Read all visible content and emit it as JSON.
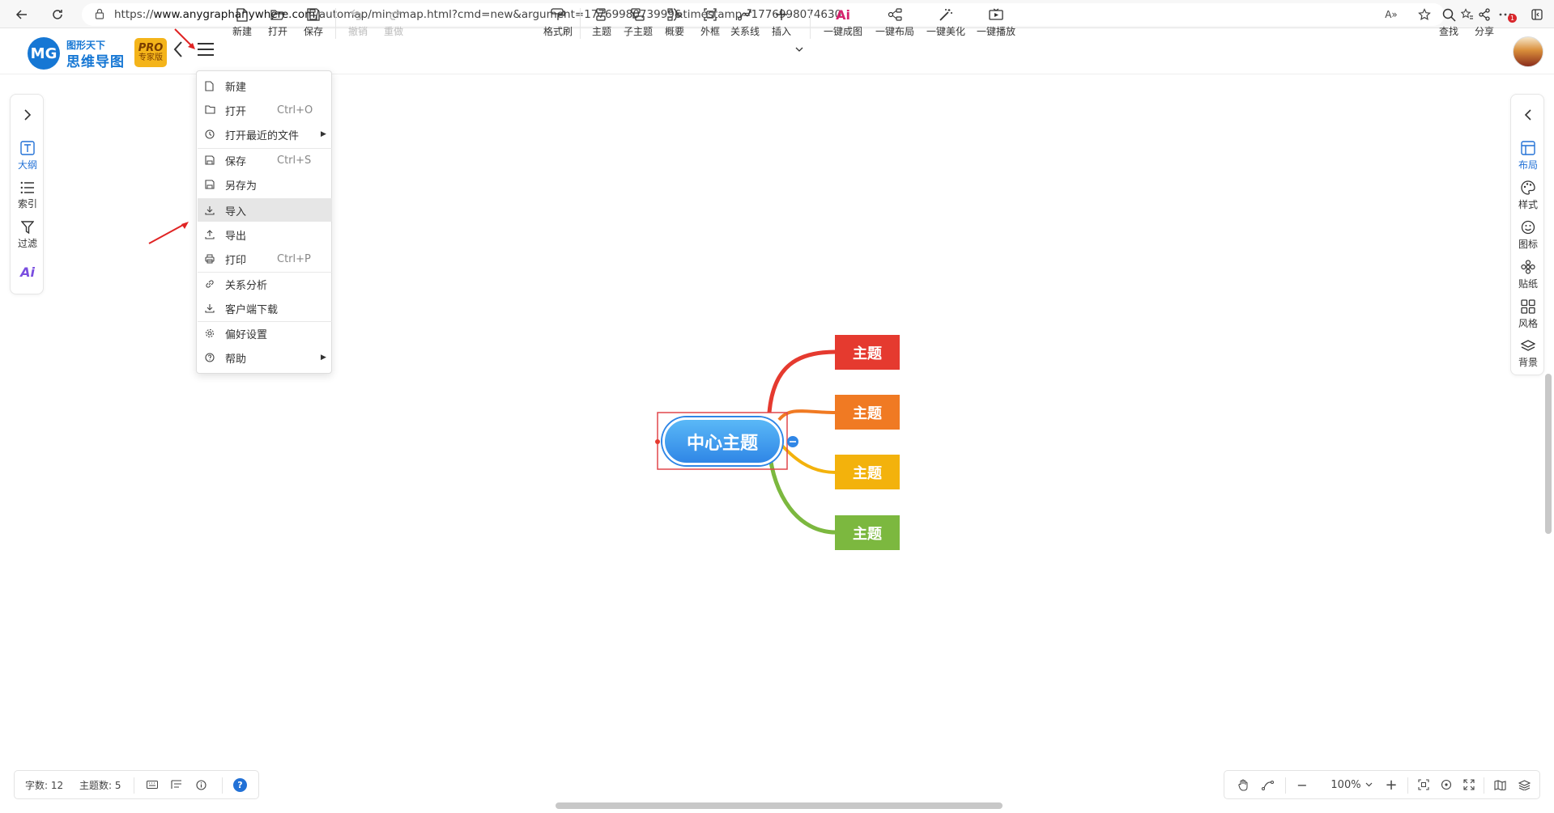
{
  "browser": {
    "url_prefix": "https://",
    "url_host": "www.anygraphanywhere.com",
    "url_path": "/automap/mindmap.html?cmd=new&argument=1776998073999&timestamp=1776998074630",
    "read_aloud": "A»",
    "notification_count": "1"
  },
  "app": {
    "logo_small": "图形天下",
    "logo_big": "思维导图",
    "logo_mark": "MG",
    "pro_label": "PRO",
    "edition": "专家版"
  },
  "toolbar": {
    "new": "新建",
    "open": "打开",
    "save": "保存",
    "undo": "撤销",
    "redo": "重做",
    "format_painter": "格式刷",
    "topic": "主题",
    "subtopic": "子主题",
    "summary": "概要",
    "boundary": "外框",
    "relation": "关系线",
    "insert": "插入",
    "ai_mark": "Ai",
    "ai_generate": "一键成图",
    "auto_layout": "一键布局",
    "beautify": "一键美化",
    "present": "一键播放",
    "find": "查找",
    "share": "分享"
  },
  "left_panel": {
    "outline": "大纲",
    "index": "索引",
    "filter": "过滤",
    "ai_mark": "Ai"
  },
  "right_panel": {
    "layout": "布局",
    "style": "样式",
    "icon": "图标",
    "sticker": "贴纸",
    "theme": "风格",
    "background": "背景"
  },
  "menu": {
    "items": [
      {
        "label": "新建",
        "shortcut": ""
      },
      {
        "label": "打开",
        "shortcut": "Ctrl+O"
      },
      {
        "label": "打开最近的文件",
        "shortcut": ""
      },
      {
        "label": "保存",
        "shortcut": "Ctrl+S"
      },
      {
        "label": "另存为",
        "shortcut": ""
      },
      {
        "label": "导入",
        "shortcut": ""
      },
      {
        "label": "导出",
        "shortcut": ""
      },
      {
        "label": "打印",
        "shortcut": "Ctrl+P"
      },
      {
        "label": "关系分析",
        "shortcut": ""
      },
      {
        "label": "客户端下载",
        "shortcut": ""
      },
      {
        "label": "偏好设置",
        "shortcut": ""
      },
      {
        "label": "帮助",
        "shortcut": ""
      }
    ],
    "highlighted": "导入"
  },
  "mindmap": {
    "center": "中心主题",
    "topics": [
      {
        "label": "主题",
        "color": "#e53a2f"
      },
      {
        "label": "主题",
        "color": "#f07a23"
      },
      {
        "label": "主题",
        "color": "#f3b20c"
      },
      {
        "label": "主题",
        "color": "#7cb83f"
      }
    ],
    "center_color": "#2f86e6"
  },
  "status": {
    "word_count": "字数: 12",
    "topic_count": "主题数: 5",
    "help": "?"
  },
  "zoom": {
    "level": "100%",
    "minus": "−",
    "plus": "+"
  }
}
